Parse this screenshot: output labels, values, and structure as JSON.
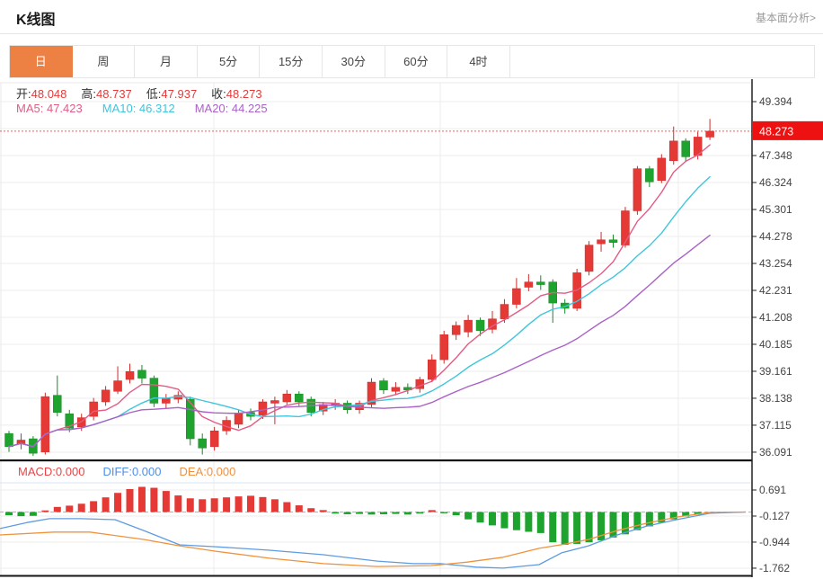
{
  "header": {
    "title": "K线图",
    "analysis_link": "基本面分析>"
  },
  "tabs": {
    "active_bg": "#ed8144",
    "items": [
      {
        "label": "日",
        "active": true
      },
      {
        "label": "周",
        "active": false
      },
      {
        "label": "月",
        "active": false
      },
      {
        "label": "5分",
        "active": false
      },
      {
        "label": "15分",
        "active": false
      },
      {
        "label": "30分",
        "active": false
      },
      {
        "label": "60分",
        "active": false
      },
      {
        "label": "4时",
        "active": false
      }
    ]
  },
  "info": {
    "label_color": "#333333",
    "value_color": "#e23b3b",
    "ohlc": [
      {
        "label": "开:",
        "value": "48.048"
      },
      {
        "label": "高:",
        "value": "48.737"
      },
      {
        "label": "低:",
        "value": "47.937"
      },
      {
        "label": "收:",
        "value": "48.273"
      }
    ],
    "ma": [
      {
        "label": "MA5: ",
        "value": "47.423",
        "color": "#e25c84"
      },
      {
        "label": "MA10: ",
        "value": "46.312",
        "color": "#3ec6dd"
      },
      {
        "label": "MA20: ",
        "value": "44.225",
        "color": "#aa62c8"
      }
    ],
    "macd": [
      {
        "label": "MACD:",
        "value": "0.000",
        "color": "#e84545"
      },
      {
        "label": "DIFF:",
        "value": "0.000",
        "color": "#4f8fe8"
      },
      {
        "label": "DEA:",
        "value": "0.000",
        "color": "#f09040"
      }
    ]
  },
  "chart_data": {
    "type": "candlestick+macd",
    "last_price": "48.273",
    "last_price_value": 48.273,
    "price_axis": {
      "ticks": [
        49.394,
        47.348,
        46.324,
        45.301,
        44.278,
        43.254,
        42.231,
        41.208,
        40.185,
        39.161,
        38.138,
        37.115,
        36.091
      ],
      "hidden_gridline": 48.371
    },
    "macd_axis": {
      "ticks": [
        0.691,
        -0.127,
        -0.944,
        -1.762
      ]
    },
    "vertical_gridlines_x": [
      238,
      490,
      755
    ],
    "ma_periods": [
      5,
      10,
      20
    ],
    "candles": [
      [
        36.8,
        36.9,
        36.1,
        36.3
      ],
      [
        36.4,
        36.8,
        36.2,
        36.55
      ],
      [
        36.6,
        36.7,
        35.95,
        36.05
      ],
      [
        36.1,
        38.35,
        36.0,
        38.2
      ],
      [
        38.25,
        39.0,
        37.45,
        37.6
      ],
      [
        37.55,
        37.7,
        36.85,
        37.0
      ],
      [
        37.05,
        37.55,
        36.9,
        37.4
      ],
      [
        37.45,
        38.15,
        37.3,
        38.0
      ],
      [
        38.0,
        38.6,
        37.85,
        38.45
      ],
      [
        38.4,
        39.35,
        38.3,
        38.8
      ],
      [
        38.85,
        39.45,
        38.7,
        39.15
      ],
      [
        39.2,
        39.4,
        38.7,
        38.9
      ],
      [
        38.9,
        39.0,
        37.8,
        37.95
      ],
      [
        37.95,
        38.3,
        37.75,
        38.15
      ],
      [
        38.1,
        38.4,
        37.95,
        38.25
      ],
      [
        38.1,
        38.2,
        36.35,
        36.6
      ],
      [
        36.6,
        36.8,
        36.0,
        36.25
      ],
      [
        36.3,
        37.05,
        36.15,
        36.9
      ],
      [
        36.9,
        37.45,
        36.75,
        37.3
      ],
      [
        37.15,
        37.7,
        37.0,
        37.55
      ],
      [
        37.6,
        37.75,
        37.3,
        37.45
      ],
      [
        37.5,
        38.1,
        37.35,
        38.0
      ],
      [
        37.95,
        38.2,
        37.15,
        38.05
      ],
      [
        38.0,
        38.45,
        37.9,
        38.3
      ],
      [
        38.3,
        38.4,
        37.85,
        38.0
      ],
      [
        38.1,
        38.2,
        37.45,
        37.6
      ],
      [
        37.65,
        38.0,
        37.5,
        37.9
      ],
      [
        37.85,
        38.1,
        37.7,
        37.95
      ],
      [
        37.95,
        38.05,
        37.55,
        37.7
      ],
      [
        37.7,
        38.05,
        37.55,
        37.95
      ],
      [
        37.9,
        38.9,
        37.8,
        38.75
      ],
      [
        38.8,
        38.9,
        38.3,
        38.45
      ],
      [
        38.4,
        38.75,
        38.25,
        38.55
      ],
      [
        38.55,
        38.7,
        38.3,
        38.45
      ],
      [
        38.5,
        38.95,
        38.35,
        38.85
      ],
      [
        38.85,
        39.8,
        38.75,
        39.6
      ],
      [
        39.6,
        40.7,
        39.45,
        40.55
      ],
      [
        40.55,
        41.05,
        40.35,
        40.9
      ],
      [
        40.65,
        41.3,
        40.45,
        41.1
      ],
      [
        41.1,
        41.2,
        40.5,
        40.7
      ],
      [
        40.75,
        41.45,
        40.6,
        41.15
      ],
      [
        41.15,
        41.9,
        41.0,
        41.7
      ],
      [
        41.7,
        42.7,
        41.55,
        42.3
      ],
      [
        42.35,
        42.85,
        42.2,
        42.55
      ],
      [
        42.55,
        42.8,
        42.25,
        42.45
      ],
      [
        42.55,
        42.65,
        41.0,
        41.75
      ],
      [
        41.75,
        41.9,
        41.35,
        41.55
      ],
      [
        41.55,
        43.05,
        41.45,
        42.9
      ],
      [
        42.95,
        44.1,
        42.8,
        43.95
      ],
      [
        44.0,
        44.45,
        43.7,
        44.15
      ],
      [
        44.15,
        44.35,
        43.85,
        44.05
      ],
      [
        43.95,
        45.4,
        43.85,
        45.25
      ],
      [
        45.25,
        46.95,
        45.1,
        46.85
      ],
      [
        46.85,
        46.95,
        46.15,
        46.35
      ],
      [
        46.4,
        47.4,
        46.3,
        47.25
      ],
      [
        47.15,
        48.45,
        47.0,
        47.9
      ],
      [
        47.9,
        48.0,
        47.1,
        47.3
      ],
      [
        47.35,
        48.25,
        47.2,
        48.05
      ],
      [
        48.048,
        48.737,
        47.937,
        48.273
      ]
    ],
    "macd_hist": [
      -0.1,
      -0.13,
      -0.12,
      0.05,
      0.16,
      0.2,
      0.26,
      0.34,
      0.46,
      0.6,
      0.72,
      0.79,
      0.76,
      0.66,
      0.52,
      0.43,
      0.4,
      0.43,
      0.46,
      0.49,
      0.51,
      0.47,
      0.4,
      0.31,
      0.21,
      0.12,
      0.06,
      -0.05,
      -0.07,
      -0.06,
      -0.08,
      -0.07,
      -0.06,
      -0.08,
      -0.05,
      0.06,
      -0.04,
      -0.1,
      -0.23,
      -0.33,
      -0.42,
      -0.51,
      -0.57,
      -0.62,
      -0.66,
      -0.95,
      -1.03,
      -1.0,
      -0.95,
      -0.89,
      -0.8,
      -0.7,
      -0.57,
      -0.45,
      -0.33,
      -0.23,
      -0.14,
      -0.08,
      -0.04
    ],
    "diff_line": [
      [
        0,
        -0.52
      ],
      [
        30,
        -0.33
      ],
      [
        55,
        -0.21
      ],
      [
        90,
        -0.21
      ],
      [
        128,
        -0.24
      ],
      [
        160,
        -0.58
      ],
      [
        200,
        -1.03
      ],
      [
        240,
        -1.09
      ],
      [
        300,
        -1.2
      ],
      [
        360,
        -1.34
      ],
      [
        420,
        -1.54
      ],
      [
        460,
        -1.62
      ],
      [
        490,
        -1.62
      ],
      [
        530,
        -1.73
      ],
      [
        560,
        -1.76
      ],
      [
        600,
        -1.65
      ],
      [
        625,
        -1.28
      ],
      [
        655,
        -1.06
      ],
      [
        687,
        -0.72
      ],
      [
        720,
        -0.44
      ],
      [
        753,
        -0.24
      ],
      [
        790,
        -0.04
      ],
      [
        830,
        0.0
      ]
    ],
    "dea_line": [
      [
        0,
        -0.72
      ],
      [
        60,
        -0.63
      ],
      [
        100,
        -0.63
      ],
      [
        160,
        -0.86
      ],
      [
        200,
        -1.06
      ],
      [
        240,
        -1.23
      ],
      [
        300,
        -1.45
      ],
      [
        360,
        -1.62
      ],
      [
        420,
        -1.71
      ],
      [
        480,
        -1.68
      ],
      [
        520,
        -1.57
      ],
      [
        560,
        -1.42
      ],
      [
        600,
        -1.14
      ],
      [
        630,
        -1.0
      ],
      [
        655,
        -0.86
      ],
      [
        687,
        -0.58
      ],
      [
        720,
        -0.35
      ],
      [
        753,
        -0.16
      ],
      [
        790,
        -0.01
      ],
      [
        830,
        0.0
      ]
    ],
    "colors": {
      "up": "#e53935",
      "up_dark": "#cf2b2b",
      "down": "#1fa32f",
      "down_dark": "#188a26",
      "ma5": "#e25c84",
      "ma10": "#3ec6dd",
      "ma20": "#aa62c8",
      "diff": "#5e9be0",
      "dea": "#f0923c",
      "last_price_line": "#ff5252",
      "badge_bg": "#ee1111",
      "grid": "#ececec",
      "frame": "#e8e8e8",
      "axis": "#222222",
      "label": "#444444",
      "zero_dash": "#9bb7e6",
      "macd_underline": "#d9e4f3",
      "divider": "#151515"
    }
  }
}
